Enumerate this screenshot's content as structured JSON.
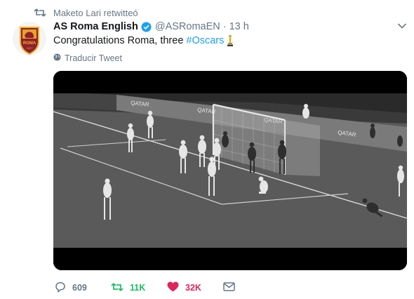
{
  "retweet": {
    "icon": "retweet-icon",
    "text": "Maketo Lari retwitteó"
  },
  "author": {
    "name": "AS Roma English",
    "handle": "@ASRomaEN",
    "separator": "·",
    "time": "13 h",
    "avatar_text": "ROMA",
    "avatar_year": "1927",
    "verified_icon": "verified-badge-icon"
  },
  "tweet": {
    "text": "Congratulations Roma, three",
    "hashtag": "#Oscars",
    "emoji": "oscar-trophy-icon"
  },
  "translate_label": "Traducir Tweet",
  "media": {
    "type": "video",
    "description_icon": "video-player-icon"
  },
  "actions": {
    "reply": {
      "icon": "reply-icon",
      "count": "609"
    },
    "retweet": {
      "icon": "retweet-icon",
      "count": "11K"
    },
    "like": {
      "icon": "heart-icon",
      "count": "32K"
    },
    "dm": {
      "icon": "envelope-icon"
    }
  },
  "colors": {
    "accent": "#1da1f2",
    "retweet": "#17bf63",
    "like": "#e0245e",
    "muted": "#657786",
    "avatar": "#8e1f2f"
  }
}
